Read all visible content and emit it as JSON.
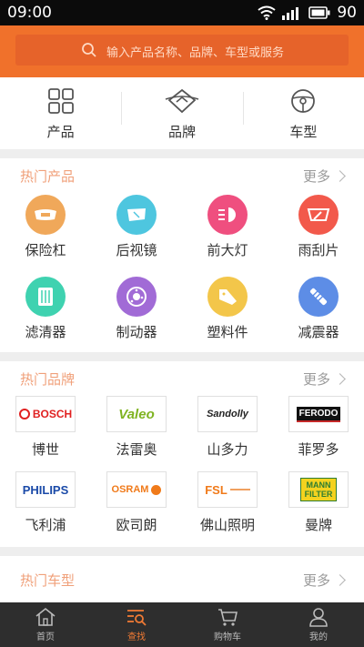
{
  "status": {
    "time": "09:00",
    "battery": "90"
  },
  "search": {
    "placeholder": "输入产品名称、品牌、车型或服务"
  },
  "categories": [
    {
      "label": "产品",
      "icon": "grid-icon"
    },
    {
      "label": "品牌",
      "icon": "badge-icon"
    },
    {
      "label": "车型",
      "icon": "steering-wheel-icon"
    }
  ],
  "hot_products": {
    "title": "热门产品",
    "more": "更多",
    "items": [
      {
        "label": "保险杠",
        "icon": "bumper-icon",
        "color": "#f0a85a"
      },
      {
        "label": "后视镜",
        "icon": "mirror-icon",
        "color": "#4ec6df"
      },
      {
        "label": "前大灯",
        "icon": "headlight-icon",
        "color": "#ef4f7f"
      },
      {
        "label": "雨刮片",
        "icon": "wiper-icon",
        "color": "#f2594b"
      },
      {
        "label": "滤清器",
        "icon": "filter-icon",
        "color": "#3fd2b0"
      },
      {
        "label": "制动器",
        "icon": "brake-icon",
        "color": "#a16bd6"
      },
      {
        "label": "塑料件",
        "icon": "plastic-part-icon",
        "color": "#f3c64a"
      },
      {
        "label": "减震器",
        "icon": "shock-absorber-icon",
        "color": "#5d8de6"
      }
    ]
  },
  "hot_brands": {
    "title": "热门品牌",
    "more": "更多",
    "items": [
      {
        "label": "博世",
        "logo": "BOSCH",
        "color": "#e02020"
      },
      {
        "label": "法雷奥",
        "logo": "Valeo",
        "color": "#7fb321"
      },
      {
        "label": "山多力",
        "logo": "Sandolly",
        "color": "#222222"
      },
      {
        "label": "菲罗多",
        "logo": "FERODO",
        "color": "#c62828"
      },
      {
        "label": "飞利浦",
        "logo": "PHILIPS",
        "color": "#1a4aa8"
      },
      {
        "label": "欧司朗",
        "logo": "OSRAM",
        "color": "#f07a1a"
      },
      {
        "label": "佛山照明",
        "logo": "FSL",
        "color": "#f07a1a"
      },
      {
        "label": "曼牌",
        "logo": "MANN FILTER",
        "color": "#2e7d32"
      }
    ]
  },
  "hot_models": {
    "title": "热门车型",
    "more": "更多"
  },
  "bottom_nav": [
    {
      "label": "首页",
      "icon": "home-icon",
      "active": false
    },
    {
      "label": "查找",
      "icon": "search-list-icon",
      "active": true
    },
    {
      "label": "购物车",
      "icon": "cart-icon",
      "active": false
    },
    {
      "label": "我的",
      "icon": "user-icon",
      "active": false
    }
  ]
}
